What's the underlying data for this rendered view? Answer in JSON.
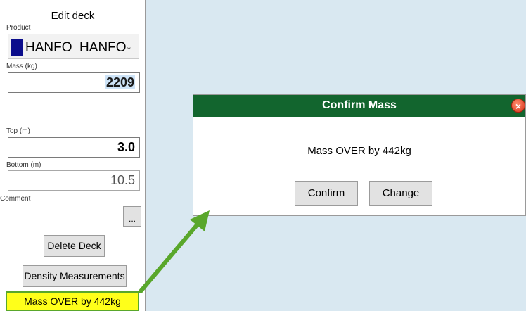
{
  "panel": {
    "title": "Edit deck",
    "product_label": "Product",
    "product_value": "HANFO  HANFO",
    "product_color": "#0b0d8c",
    "mass_label": "Mass (kg)",
    "mass_value": "2209",
    "top_label": "Top (m)",
    "top_value": "3.0",
    "bottom_label": "Bottom (m)",
    "bottom_value": "10.5",
    "comment_label": "Comment",
    "more_label": "...",
    "delete_label": "Delete Deck",
    "density_label": "Density Measurements",
    "status_text": "Mass OVER by 442kg",
    "status_color": "#ffff1a"
  },
  "dialog": {
    "title": "Confirm Mass",
    "message": "Mass OVER by 442kg",
    "confirm_label": "Confirm",
    "change_label": "Change",
    "title_bar_color": "#12652e"
  },
  "icons": {
    "close": "close-icon",
    "chevron": "chevron-down-icon",
    "annotation": "arrow-annotation"
  }
}
